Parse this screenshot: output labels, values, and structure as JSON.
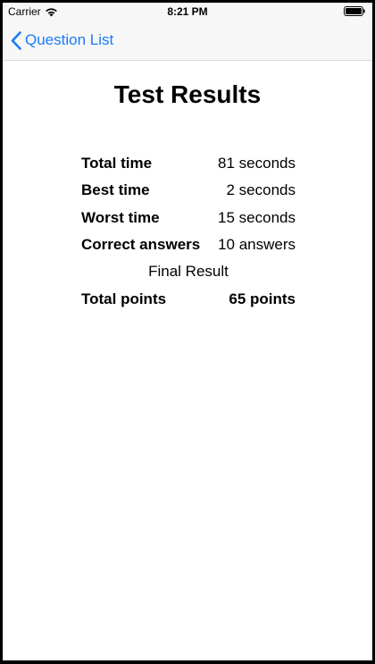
{
  "status_bar": {
    "carrier": "Carrier",
    "time": "8:21 PM"
  },
  "nav": {
    "back_label": "Question List",
    "accent_color": "#1a7cf5"
  },
  "page": {
    "title": "Test Results"
  },
  "results": {
    "total_time": {
      "label": "Total time",
      "value": "81 seconds"
    },
    "best_time": {
      "label": "Best time",
      "value": "2 seconds"
    },
    "worst_time": {
      "label": "Worst time",
      "value": "15 seconds"
    },
    "correct_answers": {
      "label": "Correct answers",
      "value": "10 answers"
    },
    "final_result_label": "Final Result",
    "total_points": {
      "label": "Total points",
      "value": "65 points"
    }
  }
}
